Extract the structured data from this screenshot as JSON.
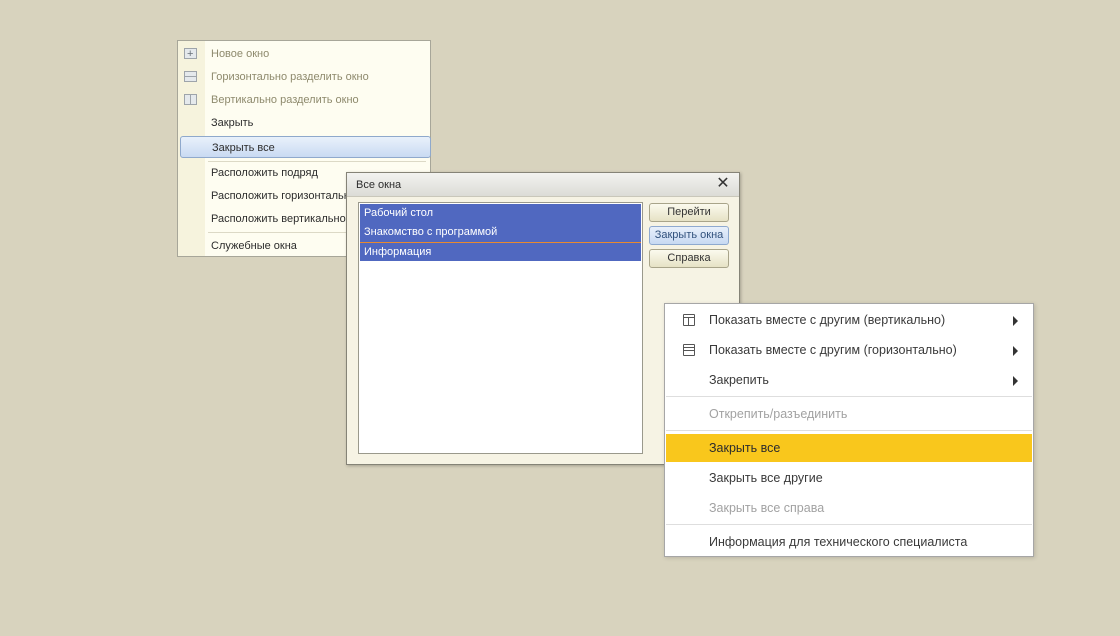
{
  "window_menu": {
    "items": [
      {
        "label": "Новое окно",
        "icon": "new-window-icon",
        "disabled": true
      },
      {
        "label": "Горизонтально разделить окно",
        "icon": "horizontal-split-icon",
        "disabled": true
      },
      {
        "label": "Вертикально разделить окно",
        "icon": "vertical-split-icon",
        "disabled": true
      },
      {
        "label": "Закрыть",
        "disabled": false
      },
      {
        "label": "Закрыть все",
        "selected": true
      },
      {
        "label": "Расположить подряд"
      },
      {
        "label": "Расположить горизонтально"
      },
      {
        "label": "Расположить вертикально"
      },
      {
        "label": "Служебные окна"
      }
    ]
  },
  "all_windows_dialog": {
    "title": "Все окна",
    "windows": [
      "Рабочий стол",
      "Знакомство с программой",
      "Информация"
    ],
    "buttons": {
      "go": "Перейти",
      "close_windows": "Закрыть окна",
      "help": "Справка"
    }
  },
  "tab_menu": {
    "items": [
      {
        "label": "Показать вместе с другим (вертикально)",
        "icon": "split-vertical-icon",
        "submenu": true
      },
      {
        "label": "Показать вместе с другим (горизонтально)",
        "icon": "split-horizontal-icon",
        "submenu": true
      },
      {
        "label": "Закрепить",
        "submenu": true
      },
      {
        "label": "Открепить/разъединить",
        "disabled": true
      },
      {
        "label": "Закрыть все",
        "selected": true
      },
      {
        "label": "Закрыть все другие"
      },
      {
        "label": "Закрыть все справа",
        "disabled": true
      },
      {
        "label": "Информация для технического специалиста"
      }
    ],
    "highlight_color": "#f9c71c"
  }
}
